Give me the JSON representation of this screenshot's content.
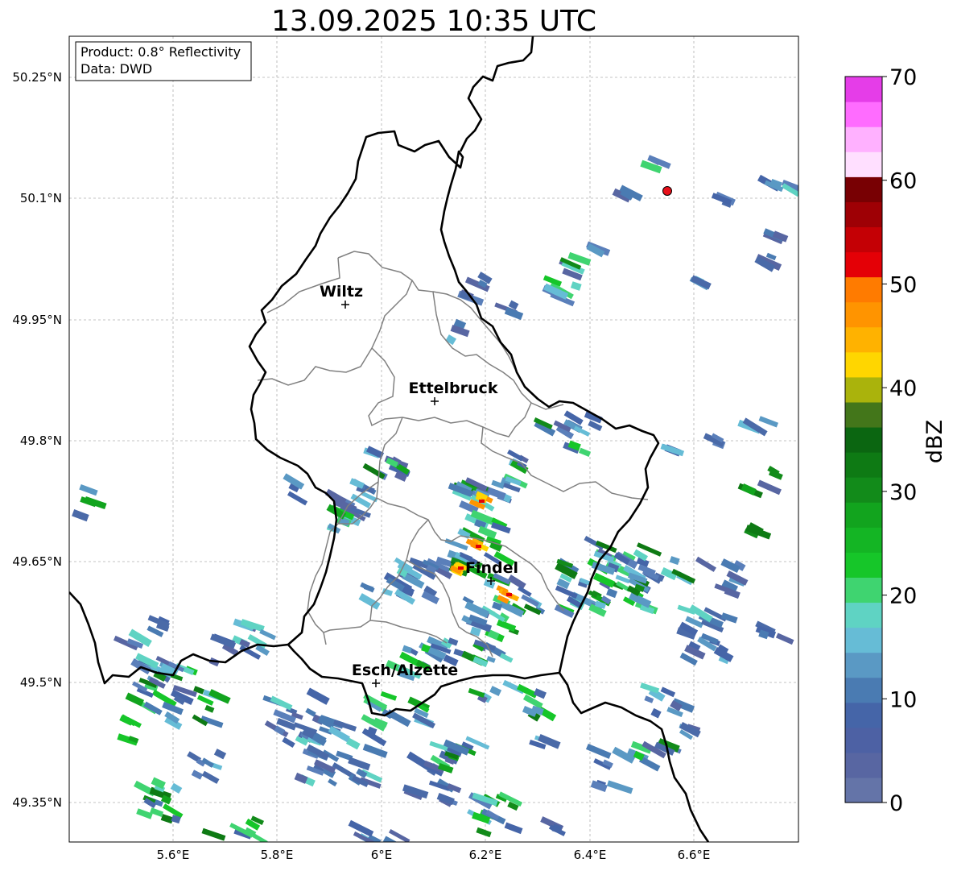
{
  "title": "13.09.2025 10:35 UTC",
  "info_box": {
    "product": "Product: 0.8° Reflectivity",
    "data": "Data: DWD"
  },
  "axes": {
    "lon_ticks": [
      "5.6°E",
      "5.8°E",
      "6°E",
      "6.2°E",
      "6.4°E",
      "6.6°E"
    ],
    "lat_ticks": [
      "50.25°N",
      "50.1°N",
      "49.95°N",
      "49.8°N",
      "49.65°N",
      "49.5°N",
      "49.35°N"
    ]
  },
  "cities": [
    "Wiltz",
    "Ettelbruck",
    "Findel",
    "Esch/Alzette"
  ],
  "colorbar": {
    "label": "dBZ",
    "ticks": [
      "0",
      "10",
      "20",
      "30",
      "40",
      "50",
      "60",
      "70"
    ],
    "colors": [
      "#6474a8",
      "#5866a2",
      "#4d61a4",
      "#4565a8",
      "#4a7bb2",
      "#5a99c4",
      "#66bcd6",
      "#5fd3c3",
      "#3fd470",
      "#16c629",
      "#14b524",
      "#12a41e",
      "#128b1a",
      "#0e7a14",
      "#0b6611",
      "#43761a",
      "#aab30c",
      "#ffd600",
      "#ffb200",
      "#ff9400",
      "#ff7b00",
      "#e40006",
      "#c40005",
      "#9e0005",
      "#780003",
      "#ffdfff",
      "#ffb1ff",
      "#ff6cff",
      "#e53de8"
    ]
  },
  "marker": {
    "color": "#e8101a"
  }
}
